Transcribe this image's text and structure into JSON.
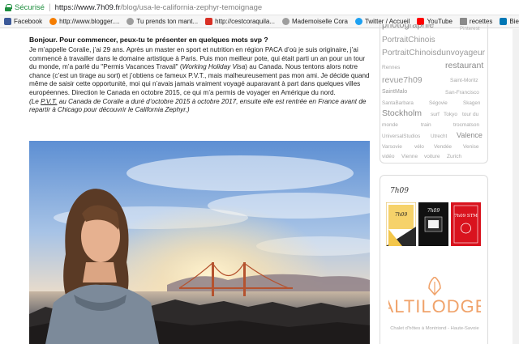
{
  "browser": {
    "secure_label": "Sécurisé",
    "url_host": "https://www.7h09.fr",
    "url_path": "/blog/usa-le-california-zephyr-temoignage",
    "bookmarks": [
      {
        "label": "Facebook",
        "icon": "facebook-icon"
      },
      {
        "label": "http://www.blogger....",
        "icon": "blogger-icon"
      },
      {
        "label": "Tu prends ton mant...",
        "icon": "globe-icon"
      },
      {
        "label": "http://cestcoraquila...",
        "icon": "bookmark-icon"
      },
      {
        "label": "Mademoiselle Cora",
        "icon": "globe-icon"
      },
      {
        "label": "Twitter / Accueil",
        "icon": "twitter-icon"
      },
      {
        "label": "YouTube",
        "icon": "youtube-icon"
      },
      {
        "label": "recettes",
        "icon": "folder-icon"
      },
      {
        "label": "Bienvenue",
        "icon": "linkedin-icon"
      }
    ]
  },
  "article": {
    "question": "Bonjour. Pour commencer, peux-tu te présenter en quelques mots svp ?",
    "para_part1": "Je m’appelle Coralie, j’ai 29 ans. Après un master en sport et nutrition en région PACA d’où je suis originaire, j’ai commencé à travailler dans le domaine artistique à Paris. Puis mon meilleur pote, qui était parti un an pour un tour du monde, m’a parlé du \"Permis Vacances Travail\" (",
    "para_italic": "Working Holiday Visa",
    "para_part2": ") au Canada. Nous tentons alors notre chance (c’est un tirage au sort) et j’obtiens ce fameux P.V.T., mais malheureusement pas mon ami. Je décide quand même de saisir cette opportunité, moi qui n’avais jamais vraiment voyagé auparavant à part dans quelques villes européennes. Direction le Canada en octobre 2015, ce qui m’a permis de voyager en Amérique du nord.",
    "note_open": "(Le ",
    "note_link": "P.V.T.",
    "note_rest": " au Canada de Coralie a duré d’octobre 2015 à octobre 2017, ensuite elle est rentrée en France avant de repartir à Chicago pour découvrir le California Zephyr.)"
  },
  "sidebar": {
    "tags": [
      "photographie",
      "Pinterest",
      "PortraitChinois",
      "PortraitChinoisdunvoyageur",
      "Rennes",
      "restaurant",
      "revue7h09",
      "Saint-Moritz",
      "SaintMalo",
      "San-Francisco",
      "SantaBarbara",
      "Ségovie",
      "Skagen",
      "Stockholm",
      "surf",
      "Tokyo",
      "tour du",
      "monde",
      "train",
      "trocmatson",
      "UniversalStudios",
      "Utrecht",
      "Valence",
      "Varsovie",
      "vélo",
      "Vendée",
      "Venise",
      "vidéo",
      "Vienne",
      "voiture",
      "Zurich"
    ],
    "promo_logo": "7h09",
    "thumb1_text": "7h09",
    "thumb2_text": "7h09",
    "thumb3_text": "7h09 STM",
    "altilodge": "ALTILODGE",
    "altilodge_sub": "Chalet d’hôtes à Montriond - Haute-Savoie"
  },
  "colors": {
    "secure_green": "#1e8e3e",
    "tag_gray": "#9a9a9a",
    "altilodge_orange": "#f0a36b"
  }
}
